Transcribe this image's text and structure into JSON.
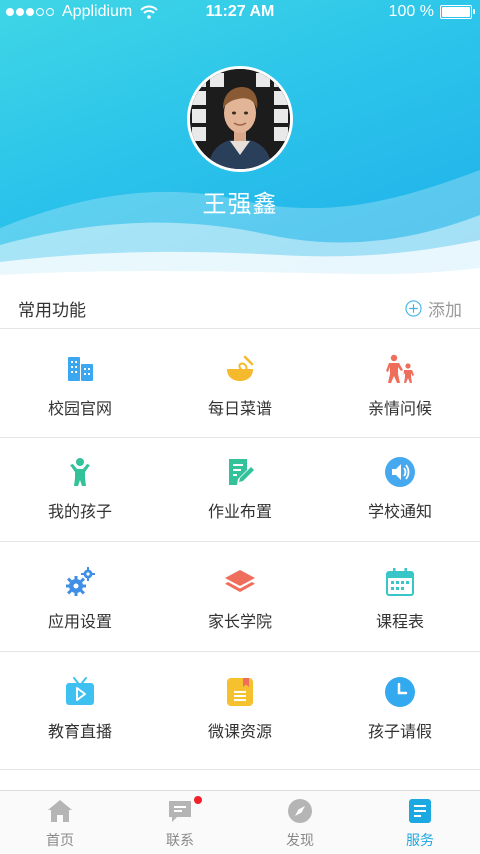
{
  "status_bar": {
    "carrier": "Applidium",
    "time": "11:27 AM",
    "battery": "100 %"
  },
  "profile": {
    "name": "王强鑫"
  },
  "section": {
    "title": "常用功能",
    "add_label": "添加"
  },
  "features": [
    {
      "label": "校园官网",
      "icon": "building-icon",
      "color": "#3aa7f0"
    },
    {
      "label": "每日菜谱",
      "icon": "mixing-bowl-icon",
      "color": "#f5b92e"
    },
    {
      "label": "亲情问候",
      "icon": "family-icon",
      "color": "#ef6e5b"
    },
    {
      "label": "我的孩子",
      "icon": "child-icon",
      "color": "#33c29a"
    },
    {
      "label": "作业布置",
      "icon": "homework-edit-icon",
      "color": "#33c29a"
    },
    {
      "label": "学校通知",
      "icon": "speaker-icon",
      "color": "#46a8ee"
    },
    {
      "label": "应用设置",
      "icon": "gears-icon",
      "color": "#3f8fe6"
    },
    {
      "label": "家长学院",
      "icon": "layers-icon",
      "color": "#ef6e5b"
    },
    {
      "label": "课程表",
      "icon": "calendar-icon",
      "color": "#38c6c9"
    },
    {
      "label": "教育直播",
      "icon": "tv-play-icon",
      "color": "#3ec0f0"
    },
    {
      "label": "微课资源",
      "icon": "notebook-icon",
      "color": "#f5c12e"
    },
    {
      "label": "孩子请假",
      "icon": "clock-icon",
      "color": "#33aaf0"
    }
  ],
  "tabs": [
    {
      "label": "首页",
      "icon": "home-icon",
      "active": false
    },
    {
      "label": "联系",
      "icon": "message-icon",
      "active": false,
      "badge": true
    },
    {
      "label": "发现",
      "icon": "compass-icon",
      "active": false
    },
    {
      "label": "服务",
      "icon": "service-list-icon",
      "active": true
    }
  ],
  "colors": {
    "accent": "#1ca8e0",
    "header_gradient_start": "#3fd6e6",
    "header_gradient_end": "#1faeea",
    "badge": "#f0212a"
  }
}
